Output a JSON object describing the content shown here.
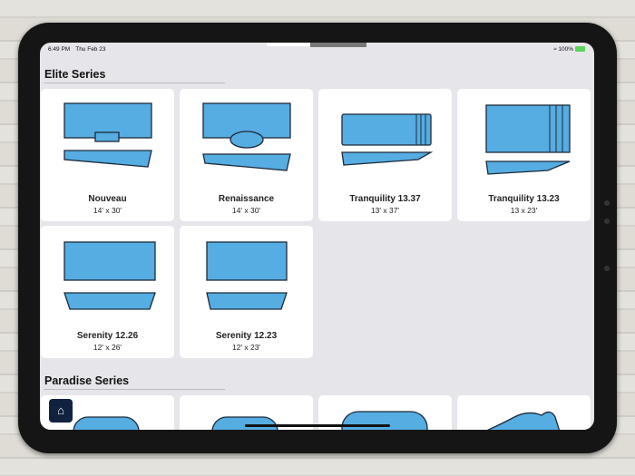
{
  "status": {
    "time": "6:49 PM",
    "date": "Thu Feb 23",
    "battery": "100%"
  },
  "sections": [
    {
      "title": "Elite Series",
      "items": [
        {
          "name": "Nouveau",
          "size": "14' x 30'"
        },
        {
          "name": "Renaissance",
          "size": "14' x 30'"
        },
        {
          "name": "Tranquility 13.37",
          "size": "13' x 37'"
        },
        {
          "name": "Tranquility 13.23",
          "size": "13 x 23'"
        },
        {
          "name": "Serenity 12.26",
          "size": "12' x 26'"
        },
        {
          "name": "Serenity 12.23",
          "size": "12' x 23'"
        }
      ]
    },
    {
      "title": "Paradise Series"
    }
  ],
  "colors": {
    "pool": "#55ade2",
    "outline": "#1e2a3a",
    "home_button": "#11223f"
  },
  "home_icon": "house-icon"
}
